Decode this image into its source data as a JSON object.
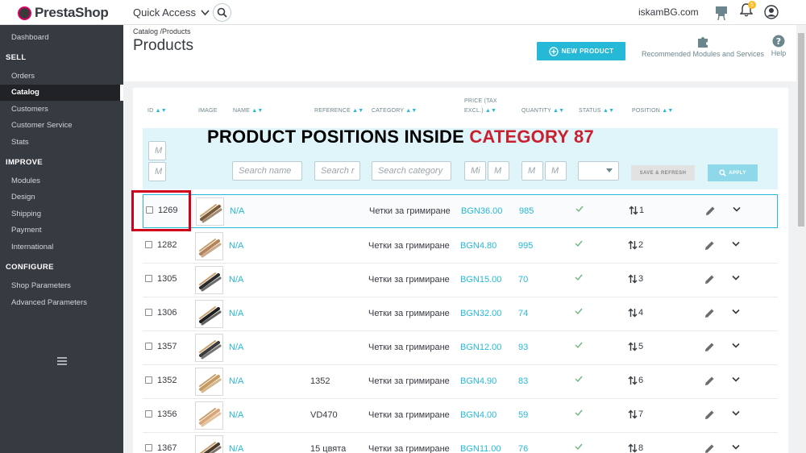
{
  "header": {
    "logo_text": "PrestaShop",
    "quick_access": "Quick Access",
    "shop_name": "iskamBG.com",
    "notification_count": "5"
  },
  "sidebar": {
    "items": [
      {
        "label": "Dashboard"
      },
      {
        "section": "SELL"
      },
      {
        "label": "Orders"
      },
      {
        "label": "Catalog",
        "active": true
      },
      {
        "label": "Customers"
      },
      {
        "label": "Customer Service"
      },
      {
        "label": "Stats"
      },
      {
        "section": "IMPROVE"
      },
      {
        "label": "Modules"
      },
      {
        "label": "Design"
      },
      {
        "label": "Shipping"
      },
      {
        "label": "Payment"
      },
      {
        "label": "International"
      },
      {
        "section": "CONFIGURE"
      },
      {
        "label": "Shop Parameters"
      },
      {
        "label": "Advanced Parameters"
      }
    ]
  },
  "page": {
    "breadcrumb": "Catalog /Products",
    "title": "Products",
    "new_product": "NEW PRODUCT",
    "recommended": "Recommended Modules and Services",
    "help": "Help"
  },
  "table": {
    "columns": {
      "id": "ID",
      "image": "IMAGE",
      "name": "NAME",
      "reference": "REFERENCE",
      "category": "CATEGORY",
      "price_1": "PRICE (TAX",
      "price_2": "EXCL.)",
      "quantity": "QUANTITY",
      "status": "STATUS",
      "position": "POSITION"
    },
    "filters": {
      "id_min": "M",
      "id_max": "M",
      "name": "Search name",
      "reference": "Search r",
      "category": "Search category",
      "price_min": "Mi",
      "price_max": "M",
      "qty_min": "M",
      "qty_max": "M",
      "save": "SAVE & REFRESH",
      "apply": "APPLY"
    },
    "overlay": {
      "black": "PRODUCT POSITIONS INSIDE ",
      "red": "CATEGORY 87"
    },
    "rows": [
      {
        "id": "1269",
        "name": "N/A",
        "reference": "",
        "category": "Четки за гримиране",
        "price": "BGN36.00",
        "quantity": "985",
        "position": "1"
      },
      {
        "id": "1282",
        "name": "N/A",
        "reference": "",
        "category": "Четки за гримиране",
        "price": "BGN4.80",
        "quantity": "995",
        "position": "2"
      },
      {
        "id": "1305",
        "name": "N/A",
        "reference": "",
        "category": "Четки за гримиране",
        "price": "BGN15.00",
        "quantity": "70",
        "position": "3"
      },
      {
        "id": "1306",
        "name": "N/A",
        "reference": "",
        "category": "Четки за гримиране",
        "price": "BGN32.00",
        "quantity": "74",
        "position": "4"
      },
      {
        "id": "1357",
        "name": "N/A",
        "reference": "",
        "category": "Четки за гримиране",
        "price": "BGN12.00",
        "quantity": "93",
        "position": "5"
      },
      {
        "id": "1352",
        "name": "N/A",
        "reference": "1352",
        "category": "Четки за гримиране",
        "price": "BGN4.90",
        "quantity": "83",
        "position": "6"
      },
      {
        "id": "1356",
        "name": "N/A",
        "reference": "VD470",
        "category": "Четки за гримиране",
        "price": "BGN4.00",
        "quantity": "59",
        "position": "7"
      },
      {
        "id": "1367",
        "name": "N/A",
        "reference": "15 цвята",
        "category": "Четки за гримиране",
        "price": "BGN11.00",
        "quantity": "76",
        "position": "8"
      }
    ]
  },
  "colors": {
    "accent": "#25b9d7",
    "sidebar": "#363a41",
    "highlight_red": "#d0021b"
  }
}
